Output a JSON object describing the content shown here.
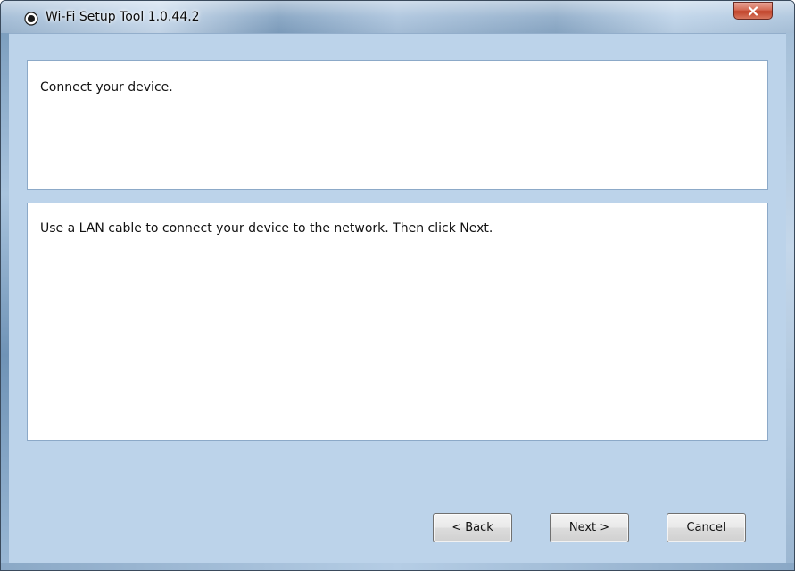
{
  "window": {
    "title": "Wi-Fi Setup Tool 1.0.44.2",
    "close_icon": "close-x-icon",
    "app_icon": "radio-dot-icon"
  },
  "header": {
    "instruction": "Connect your device."
  },
  "main": {
    "description": "Use a LAN cable to connect your device to the network. Then click Next."
  },
  "buttons": {
    "back_label": "< Back",
    "next_label": "Next >",
    "cancel_label": "Cancel"
  },
  "colors": {
    "window_frame": "#b9d1ea",
    "close_button": "#c0432a",
    "panel_background": "#ffffff"
  }
}
